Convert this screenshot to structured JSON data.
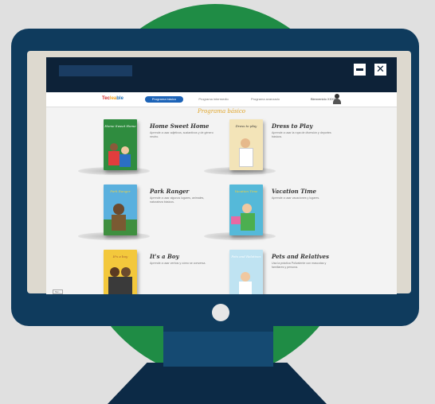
{
  "window": {
    "minimize_glyph": "",
    "close_glyph": "✕"
  },
  "nav": {
    "logo": [
      "Tec",
      "lea",
      "ble"
    ],
    "tabs": [
      {
        "label": "Programa básico",
        "active": true
      },
      {
        "label": "Programa intermedio",
        "active": false
      },
      {
        "label": "Programa avanzado",
        "active": false
      }
    ],
    "user_label": "Bienvenido XXXX"
  },
  "section_title": "Programa básico",
  "books": [
    {
      "title": "Home Sweet Home",
      "desc": "Aprende a usar adjetivos, sustantivos y de género neutro.",
      "cover_text": "Home Sweet Home",
      "cover_color": "#2f8c3f"
    },
    {
      "title": "Dress to Play",
      "desc": "Aprende a usar la ropa de diversión y deportes básicos.",
      "cover_text": "Dress to play",
      "cover_color": "#f3e4b8"
    },
    {
      "title": "Park Ranger",
      "desc": "Aprende a usar algunos lugares, animales, naturaleza básicos.",
      "cover_text": "Park Ranger",
      "cover_color": "#5ab0de"
    },
    {
      "title": "Vacation Time",
      "desc": "Aprende a usar vacaciones y lugares.",
      "cover_text": "Vacation Time",
      "cover_color": "#55b9d9"
    },
    {
      "title": "It's a Boy",
      "desc": "Aprende a usar verbos y cómo se conversa.",
      "cover_text": "It's a boy",
      "cover_color": "#f3c83c"
    },
    {
      "title": "Pets and Relatives",
      "desc": "Usa la práctica Polivalente con mascotas y familiares y persona.",
      "cover_text": "Pets and Relatives",
      "cover_color": "#bfe3f2"
    }
  ],
  "footer_tag": "Tec..."
}
